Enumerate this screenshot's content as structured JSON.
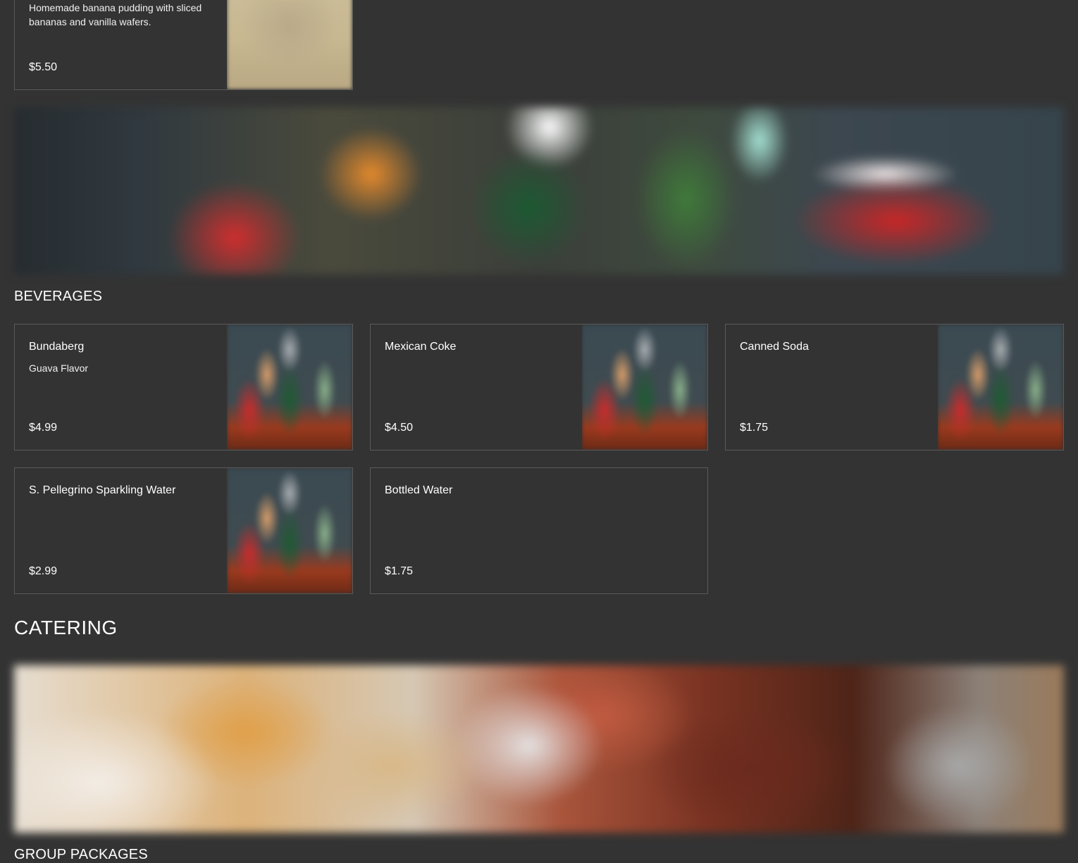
{
  "desserts": {
    "partial_item": {
      "description": "Homemade banana pudding with sliced bananas and vanilla wafers.",
      "price": "$5.50",
      "image_icon": "banana-pudding-photo"
    }
  },
  "beverages": {
    "title": "BEVERAGES",
    "items": [
      {
        "name": "Bundaberg",
        "description": "Guava Flavor",
        "price": "$4.99",
        "has_image": true
      },
      {
        "name": "Mexican Coke",
        "description": "",
        "price": "$4.50",
        "has_image": true
      },
      {
        "name": "Canned Soda",
        "description": "",
        "price": "$1.75",
        "has_image": true
      },
      {
        "name": "S. Pellegrino Sparkling Water",
        "description": "",
        "price": "$2.99",
        "has_image": true
      },
      {
        "name": "Bottled Water",
        "description": "",
        "price": "$1.75",
        "has_image": false
      }
    ]
  },
  "catering": {
    "title": "CATERING",
    "subsection_title": "GROUP PACKAGES"
  }
}
